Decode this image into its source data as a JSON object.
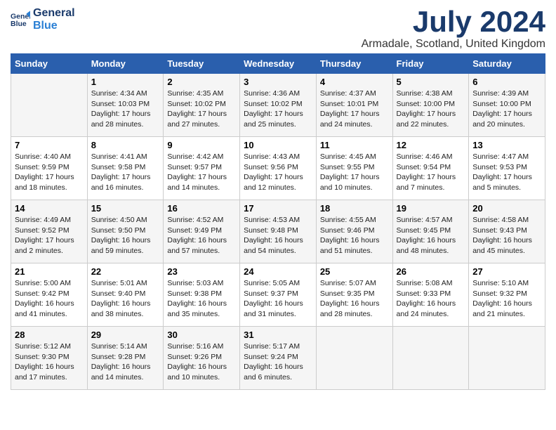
{
  "header": {
    "logo_line1": "General",
    "logo_line2": "Blue",
    "month": "July 2024",
    "location": "Armadale, Scotland, United Kingdom"
  },
  "weekdays": [
    "Sunday",
    "Monday",
    "Tuesday",
    "Wednesday",
    "Thursday",
    "Friday",
    "Saturday"
  ],
  "weeks": [
    [
      {
        "day": "",
        "text": ""
      },
      {
        "day": "1",
        "text": "Sunrise: 4:34 AM\nSunset: 10:03 PM\nDaylight: 17 hours and 28 minutes."
      },
      {
        "day": "2",
        "text": "Sunrise: 4:35 AM\nSunset: 10:02 PM\nDaylight: 17 hours and 27 minutes."
      },
      {
        "day": "3",
        "text": "Sunrise: 4:36 AM\nSunset: 10:02 PM\nDaylight: 17 hours and 25 minutes."
      },
      {
        "day": "4",
        "text": "Sunrise: 4:37 AM\nSunset: 10:01 PM\nDaylight: 17 hours and 24 minutes."
      },
      {
        "day": "5",
        "text": "Sunrise: 4:38 AM\nSunset: 10:00 PM\nDaylight: 17 hours and 22 minutes."
      },
      {
        "day": "6",
        "text": "Sunrise: 4:39 AM\nSunset: 10:00 PM\nDaylight: 17 hours and 20 minutes."
      }
    ],
    [
      {
        "day": "7",
        "text": "Sunrise: 4:40 AM\nSunset: 9:59 PM\nDaylight: 17 hours and 18 minutes."
      },
      {
        "day": "8",
        "text": "Sunrise: 4:41 AM\nSunset: 9:58 PM\nDaylight: 17 hours and 16 minutes."
      },
      {
        "day": "9",
        "text": "Sunrise: 4:42 AM\nSunset: 9:57 PM\nDaylight: 17 hours and 14 minutes."
      },
      {
        "day": "10",
        "text": "Sunrise: 4:43 AM\nSunset: 9:56 PM\nDaylight: 17 hours and 12 minutes."
      },
      {
        "day": "11",
        "text": "Sunrise: 4:45 AM\nSunset: 9:55 PM\nDaylight: 17 hours and 10 minutes."
      },
      {
        "day": "12",
        "text": "Sunrise: 4:46 AM\nSunset: 9:54 PM\nDaylight: 17 hours and 7 minutes."
      },
      {
        "day": "13",
        "text": "Sunrise: 4:47 AM\nSunset: 9:53 PM\nDaylight: 17 hours and 5 minutes."
      }
    ],
    [
      {
        "day": "14",
        "text": "Sunrise: 4:49 AM\nSunset: 9:52 PM\nDaylight: 17 hours and 2 minutes."
      },
      {
        "day": "15",
        "text": "Sunrise: 4:50 AM\nSunset: 9:50 PM\nDaylight: 16 hours and 59 minutes."
      },
      {
        "day": "16",
        "text": "Sunrise: 4:52 AM\nSunset: 9:49 PM\nDaylight: 16 hours and 57 minutes."
      },
      {
        "day": "17",
        "text": "Sunrise: 4:53 AM\nSunset: 9:48 PM\nDaylight: 16 hours and 54 minutes."
      },
      {
        "day": "18",
        "text": "Sunrise: 4:55 AM\nSunset: 9:46 PM\nDaylight: 16 hours and 51 minutes."
      },
      {
        "day": "19",
        "text": "Sunrise: 4:57 AM\nSunset: 9:45 PM\nDaylight: 16 hours and 48 minutes."
      },
      {
        "day": "20",
        "text": "Sunrise: 4:58 AM\nSunset: 9:43 PM\nDaylight: 16 hours and 45 minutes."
      }
    ],
    [
      {
        "day": "21",
        "text": "Sunrise: 5:00 AM\nSunset: 9:42 PM\nDaylight: 16 hours and 41 minutes."
      },
      {
        "day": "22",
        "text": "Sunrise: 5:01 AM\nSunset: 9:40 PM\nDaylight: 16 hours and 38 minutes."
      },
      {
        "day": "23",
        "text": "Sunrise: 5:03 AM\nSunset: 9:38 PM\nDaylight: 16 hours and 35 minutes."
      },
      {
        "day": "24",
        "text": "Sunrise: 5:05 AM\nSunset: 9:37 PM\nDaylight: 16 hours and 31 minutes."
      },
      {
        "day": "25",
        "text": "Sunrise: 5:07 AM\nSunset: 9:35 PM\nDaylight: 16 hours and 28 minutes."
      },
      {
        "day": "26",
        "text": "Sunrise: 5:08 AM\nSunset: 9:33 PM\nDaylight: 16 hours and 24 minutes."
      },
      {
        "day": "27",
        "text": "Sunrise: 5:10 AM\nSunset: 9:32 PM\nDaylight: 16 hours and 21 minutes."
      }
    ],
    [
      {
        "day": "28",
        "text": "Sunrise: 5:12 AM\nSunset: 9:30 PM\nDaylight: 16 hours and 17 minutes."
      },
      {
        "day": "29",
        "text": "Sunrise: 5:14 AM\nSunset: 9:28 PM\nDaylight: 16 hours and 14 minutes."
      },
      {
        "day": "30",
        "text": "Sunrise: 5:16 AM\nSunset: 9:26 PM\nDaylight: 16 hours and 10 minutes."
      },
      {
        "day": "31",
        "text": "Sunrise: 5:17 AM\nSunset: 9:24 PM\nDaylight: 16 hours and 6 minutes."
      },
      {
        "day": "",
        "text": ""
      },
      {
        "day": "",
        "text": ""
      },
      {
        "day": "",
        "text": ""
      }
    ]
  ]
}
